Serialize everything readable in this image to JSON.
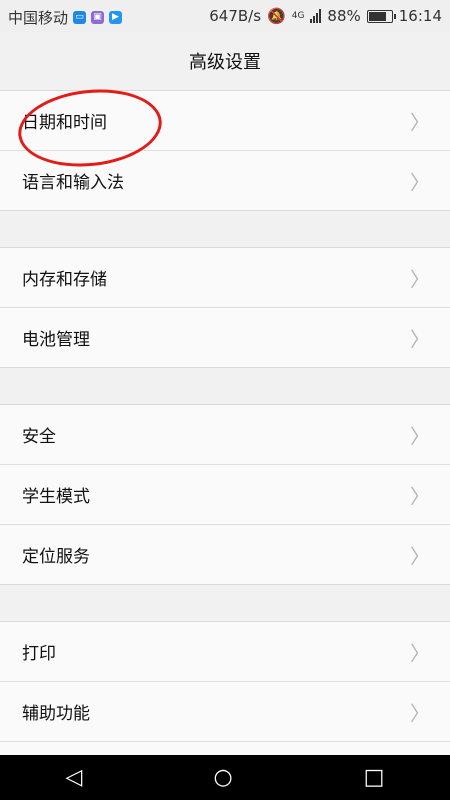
{
  "status": {
    "carrier": "中国移动",
    "speed": "647B/s",
    "network": "4G",
    "battery": "88%",
    "battery_level": 88,
    "time": "16:14"
  },
  "header": {
    "title": "高级设置"
  },
  "groups": [
    [
      "日期和时间",
      "语言和输入法"
    ],
    [
      "内存和存储",
      "电池管理"
    ],
    [
      "安全",
      "学生模式",
      "定位服务"
    ],
    [
      "打印",
      "辅助功能"
    ]
  ],
  "colors": {
    "annotation": "#e41b17"
  },
  "icons": {
    "chevron": "chevron-right-icon",
    "back": "back-icon",
    "home": "home-icon",
    "recent": "recent-apps-icon"
  }
}
